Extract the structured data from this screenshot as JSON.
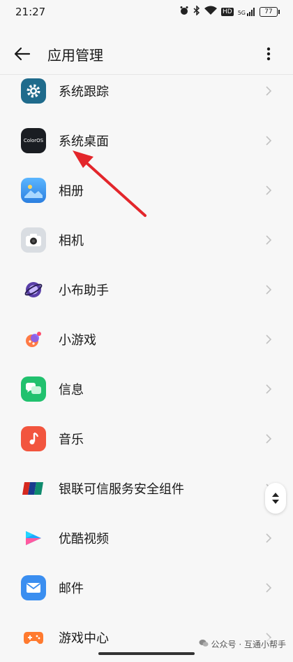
{
  "status": {
    "time": "21:27",
    "battery": "77",
    "network": "5G",
    "hd": "HD"
  },
  "header": {
    "title": "应用管理"
  },
  "apps": [
    {
      "label": "系统跟踪",
      "icon": "gear-icon",
      "bg": "#1f6b8c"
    },
    {
      "label": "系统桌面",
      "icon": "coloros-icon",
      "icon_text": "ColorOS",
      "bg": "#1a1d22"
    },
    {
      "label": "相册",
      "icon": "gallery-icon",
      "bg": "#3aa0f0"
    },
    {
      "label": "相机",
      "icon": "camera-icon",
      "bg": "#d9dde2"
    },
    {
      "label": "小布助手",
      "icon": "assistant-icon",
      "bg": "#f7f7f7"
    },
    {
      "label": "小游戏",
      "icon": "minigame-icon",
      "bg": "#f7f7f7"
    },
    {
      "label": "信息",
      "icon": "message-icon",
      "bg": "#21c16e"
    },
    {
      "label": "音乐",
      "icon": "music-icon",
      "bg": "#f2553e"
    },
    {
      "label": "银联可信服务安全组件",
      "icon": "unionpay-icon",
      "bg": "#f7f7f7"
    },
    {
      "label": "优酷视频",
      "icon": "youku-icon",
      "bg": "#f7f7f7"
    },
    {
      "label": "邮件",
      "icon": "mail-icon",
      "bg": "#3a8ef0"
    },
    {
      "label": "游戏中心",
      "icon": "game-center-icon",
      "bg": "#f7f7f7"
    }
  ],
  "watermark": "公众号 · 互通小帮手"
}
